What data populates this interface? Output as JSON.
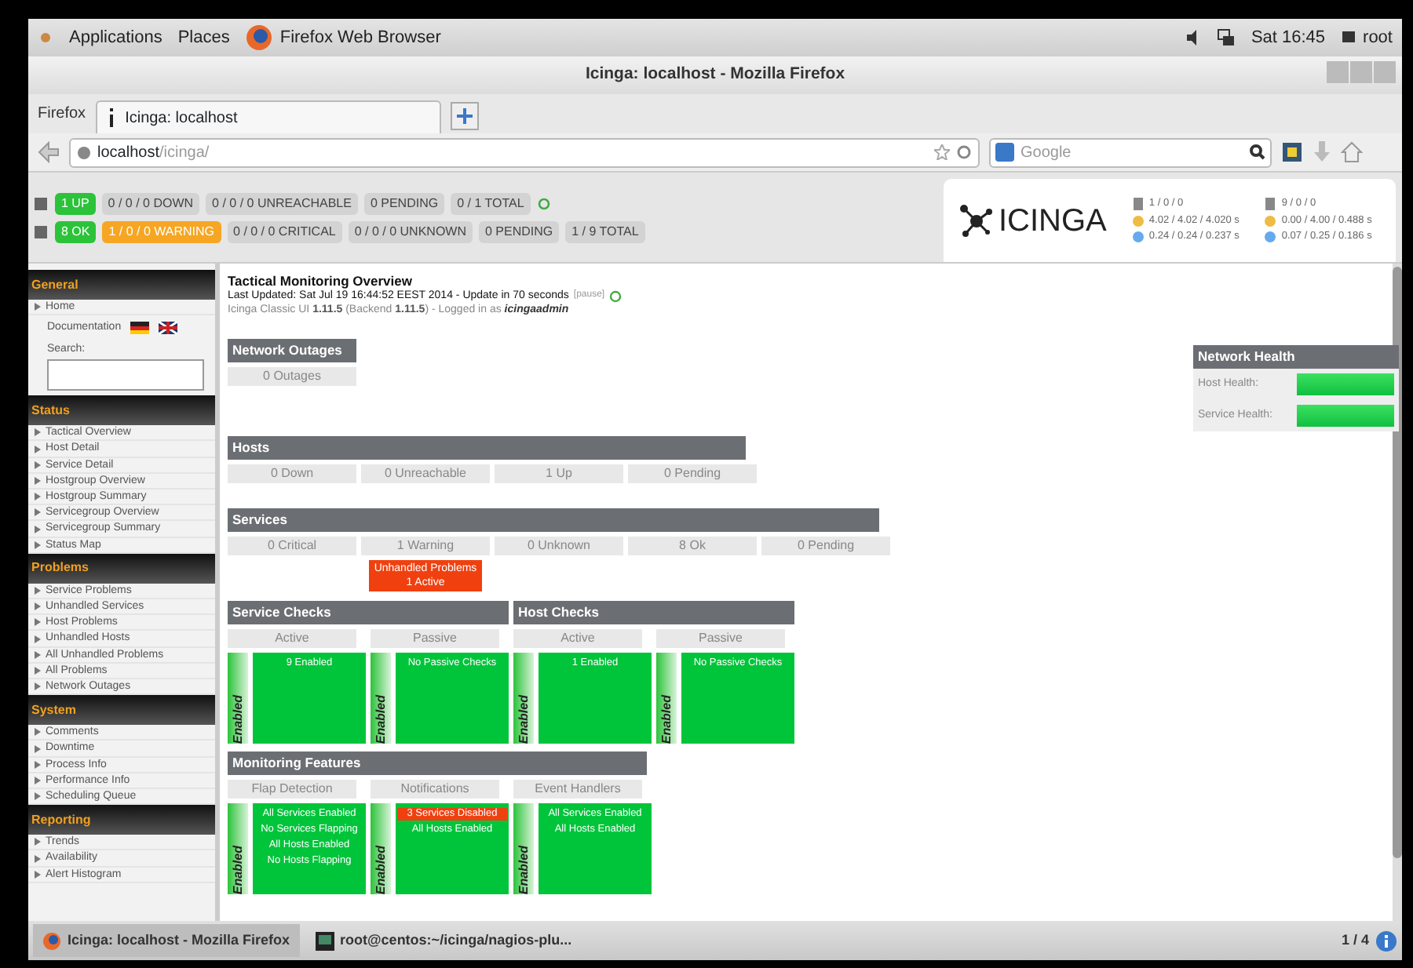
{
  "desktop_bar": {
    "menus": [
      "Applications",
      "Places"
    ],
    "active_app": "Firefox Web Browser",
    "clock": "Sat 16:45",
    "user": "root"
  },
  "window": {
    "title": "Icinga: localhost - Mozilla Firefox"
  },
  "browser": {
    "menu": "Firefox",
    "tabs": [
      {
        "label": "Icinga: localhost",
        "selected": true
      }
    ],
    "url_host": "localhost",
    "url_path": "/icinga/",
    "search_placeholder": "Google"
  },
  "status_header": {
    "host_row": [
      {
        "text": "1 UP",
        "kind": "ok"
      },
      {
        "text": "0 / 0 / 0 DOWN",
        "kind": "neutral"
      },
      {
        "text": "0 / 0 / 0 UNREACHABLE",
        "kind": "neutral"
      },
      {
        "text": "0 PENDING",
        "kind": "neutral"
      },
      {
        "text": "0 / 1 TOTAL",
        "kind": "neutral"
      }
    ],
    "service_row": [
      {
        "text": "8 OK",
        "kind": "ok"
      },
      {
        "text": "1 / 0 / 0 WARNING",
        "kind": "warning"
      },
      {
        "text": "0 / 0 / 0 CRITICAL",
        "kind": "neutral"
      },
      {
        "text": "0 / 0 / 0 UNKNOWN",
        "kind": "neutral"
      },
      {
        "text": "0 PENDING",
        "kind": "neutral"
      },
      {
        "text": "1 / 9 TOTAL",
        "kind": "neutral"
      }
    ],
    "logo": "ICINGA",
    "host_stats": [
      "1 / 0 / 0",
      "4.02 / 4.02 / 4.020 s",
      "0.24 / 0.24 / 0.237 s"
    ],
    "service_stats": [
      "9 / 0 / 0",
      "0.00 / 4.00 / 0.488 s",
      "0.07 / 0.25 / 0.186 s"
    ]
  },
  "sidebar": [
    {
      "title": "General",
      "items": [
        {
          "label": "Home",
          "kind": "link"
        },
        {
          "label": "Documentation",
          "kind": "docs"
        },
        {
          "label": "Search:",
          "kind": "search"
        }
      ]
    },
    {
      "title": "Status",
      "items": [
        {
          "label": "Tactical Overview",
          "kind": "link"
        },
        {
          "label": "Host Detail",
          "kind": "link"
        },
        {
          "label": "Service Detail",
          "kind": "link"
        },
        {
          "label": "Hostgroup Overview",
          "kind": "link"
        },
        {
          "label": "Hostgroup Summary",
          "kind": "link"
        },
        {
          "label": "Servicegroup Overview",
          "kind": "link"
        },
        {
          "label": "Servicegroup Summary",
          "kind": "link"
        },
        {
          "label": "Status Map",
          "kind": "link"
        }
      ]
    },
    {
      "title": "Problems",
      "items": [
        {
          "label": "Service Problems",
          "kind": "link"
        },
        {
          "label": "Unhandled Services",
          "kind": "link"
        },
        {
          "label": "Host Problems",
          "kind": "link"
        },
        {
          "label": "Unhandled Hosts",
          "kind": "link"
        },
        {
          "label": "All Unhandled Problems",
          "kind": "link"
        },
        {
          "label": "All Problems",
          "kind": "link"
        },
        {
          "label": "Network Outages",
          "kind": "link"
        }
      ]
    },
    {
      "title": "System",
      "items": [
        {
          "label": "Comments",
          "kind": "link"
        },
        {
          "label": "Downtime",
          "kind": "link"
        },
        {
          "label": "Process Info",
          "kind": "link"
        },
        {
          "label": "Performance Info",
          "kind": "link"
        },
        {
          "label": "Scheduling Queue",
          "kind": "link"
        }
      ]
    },
    {
      "title": "Reporting",
      "items": [
        {
          "label": "Trends",
          "kind": "link"
        },
        {
          "label": "Availability",
          "kind": "link"
        },
        {
          "label": "Alert Histogram",
          "kind": "link"
        }
      ]
    }
  ],
  "main": {
    "title": "Tactical Monitoring Overview",
    "last_updated": "Last Updated: Sat Jul 19 16:44:52 EEST 2014 - Update in 70 seconds",
    "pause_link": "[pause]",
    "version_line": "Icinga Classic UI **1.11.5** (Backend **1.11.5**) - Logged in as *icingaadmin*",
    "network_outages": {
      "title": "Network Outages",
      "cells": [
        "0 Outages"
      ]
    },
    "hosts": {
      "title": "Hosts",
      "cells": [
        "0 Down",
        "0 Unreachable",
        "1 Up",
        "0 Pending"
      ]
    },
    "services": {
      "title": "Services",
      "cells": [
        {
          "text": "0 Critical"
        },
        {
          "text": "1 Warning",
          "unhandled": [
            "Unhandled Problems",
            "1 Active"
          ]
        },
        {
          "text": "0 Unknown"
        },
        {
          "text": "8 Ok"
        },
        {
          "text": "0 Pending"
        }
      ]
    },
    "check_groups": [
      {
        "title": "Service Checks",
        "columns": [
          {
            "heading": "Active",
            "state": "Enabled",
            "lines": [
              {
                "text": "9 Enabled",
                "kind": "normal"
              }
            ]
          },
          {
            "heading": "Passive",
            "state": "Enabled",
            "lines": [
              {
                "text": "No Passive Checks",
                "kind": "normal"
              }
            ]
          }
        ]
      },
      {
        "title": "Host Checks",
        "columns": [
          {
            "heading": "Active",
            "state": "Enabled",
            "lines": [
              {
                "text": "1 Enabled",
                "kind": "normal"
              }
            ]
          },
          {
            "heading": "Passive",
            "state": "Enabled",
            "lines": [
              {
                "text": "No Passive Checks",
                "kind": "normal"
              }
            ]
          }
        ]
      }
    ],
    "monitoring_features": {
      "title": "Monitoring Features",
      "columns": [
        {
          "heading": "Flap Detection",
          "state": "Enabled",
          "lines": [
            {
              "text": "All Services Enabled",
              "kind": "normal"
            },
            {
              "text": "No Services Flapping",
              "kind": "normal"
            },
            {
              "text": "All Hosts Enabled",
              "kind": "normal"
            },
            {
              "text": "No Hosts Flapping",
              "kind": "normal"
            }
          ]
        },
        {
          "heading": "Notifications",
          "state": "Enabled",
          "lines": [
            {
              "text": "3 Services Disabled",
              "kind": "problem"
            },
            {
              "text": "All Hosts Enabled",
              "kind": "normal"
            }
          ]
        },
        {
          "heading": "Event Handlers",
          "state": "Enabled",
          "lines": [
            {
              "text": "All Services Enabled",
              "kind": "normal"
            },
            {
              "text": "All Hosts Enabled",
              "kind": "normal"
            }
          ]
        }
      ]
    },
    "network_health": {
      "title": "Network Health",
      "bars": [
        {
          "label": "Host Health:",
          "level": 1.0
        },
        {
          "label": "Service Health:",
          "level": 1.0
        }
      ]
    }
  },
  "taskbar": {
    "items": [
      {
        "label": "Icinga: localhost - Mozilla Firefox",
        "selected": true
      },
      {
        "label": "root@centos:~/icinga/nagios-plu...",
        "selected": false
      }
    ],
    "pager": "1 / 4"
  }
}
